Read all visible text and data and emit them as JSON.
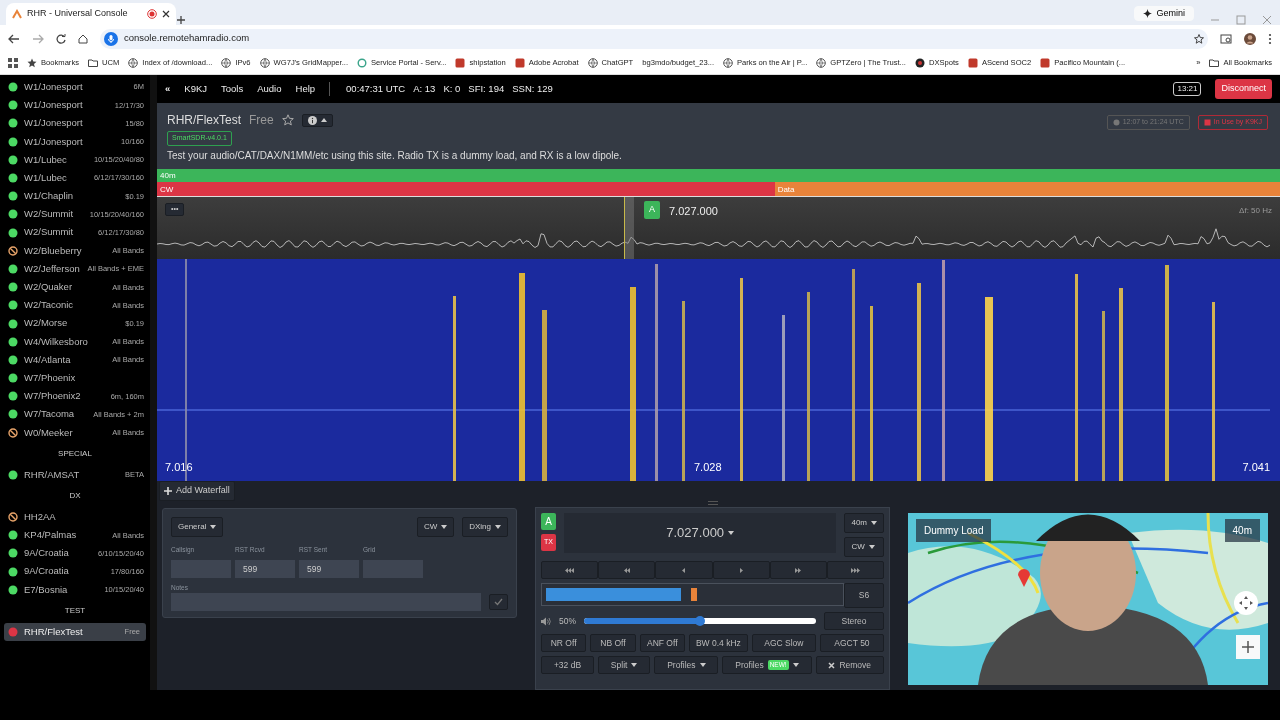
{
  "browser": {
    "tab_title": "RHR - Universal Console",
    "gemini": "Gemini",
    "address": "console.remotehamradio.com",
    "overflow": "»",
    "all_bookmarks": "All Bookmarks",
    "bookmarks": [
      {
        "label": "Bookmarks",
        "kind": "star"
      },
      {
        "label": "UCM",
        "kind": "folder"
      },
      {
        "label": "Index of /download...",
        "kind": "globe"
      },
      {
        "label": "IPv6",
        "kind": "globe"
      },
      {
        "label": "WG7J's GridMapper...",
        "kind": "globe"
      },
      {
        "label": "Service Portal - Serv...",
        "kind": "ring"
      },
      {
        "label": "shipstation",
        "kind": "square"
      },
      {
        "label": "Adobe Acrobat",
        "kind": "square"
      },
      {
        "label": "ChatGPT",
        "kind": "globe"
      },
      {
        "label": "bg3mdo/budget_23...",
        "kind": "blank"
      },
      {
        "label": "Parks on the Air | P...",
        "kind": "globe"
      },
      {
        "label": "GPTZero | The Trust...",
        "kind": "globe"
      },
      {
        "label": "DXSpots",
        "kind": "dot"
      },
      {
        "label": "AScend SOC2",
        "kind": "square"
      },
      {
        "label": "Pacifico Mountain (...",
        "kind": "square"
      }
    ]
  },
  "sidebar": {
    "sections": [
      {
        "items": [
          {
            "name": "W1/Jonesport",
            "info": "6M",
            "kind": "available",
            "selected": false
          },
          {
            "name": "W1/Jonesport",
            "info": "12/17/30",
            "kind": "available",
            "selected": false
          },
          {
            "name": "W1/Jonesport",
            "info": "15/80",
            "kind": "available",
            "selected": false
          },
          {
            "name": "W1/Jonesport",
            "info": "10/160",
            "kind": "available",
            "selected": false
          },
          {
            "name": "W1/Lubec",
            "info": "10/15/20/40/80",
            "kind": "available",
            "selected": false
          },
          {
            "name": "W1/Lubec",
            "info": "6/12/17/30/160",
            "kind": "available",
            "selected": false
          },
          {
            "name": "W1/Chaplin",
            "info": "$0.19",
            "kind": "available",
            "selected": false
          },
          {
            "name": "W2/Summit",
            "info": "10/15/20/40/160",
            "kind": "available",
            "selected": false
          },
          {
            "name": "W2/Summit",
            "info": "6/12/17/30/80",
            "kind": "available",
            "selected": false
          },
          {
            "name": "W2/Blueberry",
            "info": "All Bands",
            "kind": "unavailable",
            "selected": false
          },
          {
            "name": "W2/Jefferson",
            "info": "All Bands + EME",
            "kind": "available",
            "selected": false
          },
          {
            "name": "W2/Quaker",
            "info": "All Bands",
            "kind": "available",
            "selected": false
          },
          {
            "name": "W2/Taconic",
            "info": "All Bands",
            "kind": "available",
            "selected": false
          },
          {
            "name": "W2/Morse",
            "info": "$0.19",
            "kind": "available",
            "selected": false
          },
          {
            "name": "W4/Wilkesboro",
            "info": "All Bands",
            "kind": "available",
            "selected": false
          },
          {
            "name": "W4/Atlanta",
            "info": "All Bands",
            "kind": "available",
            "selected": false
          },
          {
            "name": "W7/Phoenix",
            "kind": "available",
            "selected": false
          },
          {
            "name": "W7/Phoenix2",
            "info": "6m, 160m",
            "kind": "available",
            "selected": false
          },
          {
            "name": "W7/Tacoma",
            "info": "All Bands + 2m",
            "kind": "available",
            "selected": false
          },
          {
            "name": "W0/Meeker",
            "info": "All Bands",
            "kind": "unavailable",
            "selected": false
          }
        ]
      },
      {
        "title": "SPECIAL",
        "items": [
          {
            "name": "RHR/AMSAT",
            "info": "BETA",
            "kind": "available",
            "selected": false
          }
        ]
      },
      {
        "title": "DX",
        "items": [
          {
            "name": "HH2AA",
            "kind": "unavailable",
            "selected": false
          },
          {
            "name": "KP4/Palmas",
            "info": "All Bands",
            "kind": "available",
            "selected": false
          },
          {
            "name": "9A/Croatia",
            "info": "6/10/15/20/40",
            "kind": "available",
            "selected": false
          },
          {
            "name": "9A/Croatia",
            "info": "17/80/160",
            "kind": "available",
            "selected": false
          },
          {
            "name": "E7/Bosnia",
            "info": "10/15/20/40",
            "kind": "available",
            "selected": false
          }
        ]
      },
      {
        "title": "TEST",
        "items": [
          {
            "name": "RHR/FlexTest",
            "info": "Free",
            "kind": "in_use",
            "selected": true
          }
        ]
      }
    ]
  },
  "toolbar": {
    "back": "«",
    "menus": [
      "K9KJ",
      "Tools",
      "Audio",
      "Help"
    ],
    "stats": [
      "00:47:31 UTC",
      "A: 13",
      "K: 0",
      "SFI: 194",
      "SSN: 129"
    ],
    "clock": "13:21",
    "disconnect": "Disconnect"
  },
  "station": {
    "name": "RHR/FlexTest",
    "tier": "Free",
    "favorite": false,
    "version": "SmartSDR-v4.0.1",
    "description": "Test your audio/CAT/DAX/N1MM/etc using this site. Radio TX is a dummy load, and RX is a low dipole.",
    "schedule": "12:07 to 21:24 UTC",
    "status": "In Use by K9KJ"
  },
  "band": {
    "name": "40m",
    "segments": [
      {
        "label": "CW",
        "color": "#dc3545"
      },
      {
        "label": "Data",
        "color": "#e8833a"
      }
    ]
  },
  "panadapter": {
    "menu": "•••",
    "slice": "A",
    "frequency": "7.027.000",
    "delta": "Δf: 50 Hz",
    "scale": [
      "7.016",
      "7.028",
      "7.041"
    ]
  },
  "add_waterfall": "Add Waterfall",
  "log": {
    "category": "General",
    "mode": "CW",
    "type": "DXing",
    "fields": [
      {
        "label": "Callsign"
      },
      {
        "label": "RST Rcvd",
        "value": "599"
      },
      {
        "label": "RST Sent",
        "value": "599"
      },
      {
        "label": "Grid"
      }
    ],
    "notes_label": "Notes"
  },
  "slice": {
    "letter": "A",
    "tx": "TX",
    "frequency": "7.027.000",
    "band": "40m",
    "mode": "CW",
    "tune": [
      {
        "kind": "fast-back"
      },
      {
        "kind": "back"
      },
      {
        "kind": "step-back"
      },
      {
        "kind": "step-forward"
      },
      {
        "kind": "forward"
      },
      {
        "kind": "fast-forward"
      }
    ],
    "meter": {
      "level": 0.46,
      "reading": "S6"
    },
    "volume": {
      "level": 0.5,
      "reading": "50%"
    },
    "stereo": "Stereo",
    "dsp": [
      "NR Off",
      "NB Off",
      "ANF Off",
      "BW 0.4 kHz",
      "AGC Slow",
      "AGCT 50"
    ],
    "actions": [
      {
        "label": "+32 dB",
        "kind": "plain"
      },
      {
        "label": "Split",
        "kind": "dropdown"
      },
      {
        "label": "Profiles",
        "kind": "dropdown"
      },
      {
        "label": "Profiles",
        "kind": "dropdown",
        "badge": "NEW!"
      },
      {
        "label": "Remove",
        "kind": "remove"
      }
    ]
  },
  "map": {
    "title": "Dummy Load",
    "band": "40m",
    "kind": "picture"
  }
}
